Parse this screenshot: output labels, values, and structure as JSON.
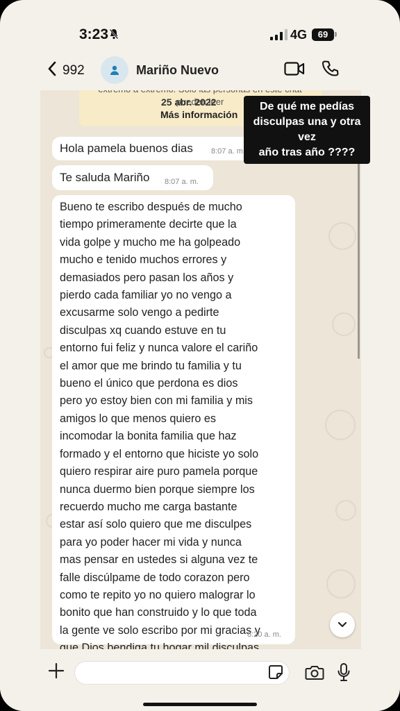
{
  "status_bar": {
    "time": "3:23",
    "network": "4G",
    "battery": "69"
  },
  "header": {
    "back_count": "992",
    "contact_name": "Mariño Nuevo"
  },
  "encryption_notice": {
    "text": "extremo a extremo. Solo las personas en este chat pueden leer",
    "date": "25 abr. 2022",
    "more_info": "Más información"
  },
  "overlay_caption": {
    "line1": "De qué me pedías",
    "line2": "disculpas una y otra vez",
    "line3": "año tras año ????"
  },
  "messages": [
    {
      "text": "Hola pamela buenos dias",
      "time": "8:07 a. m."
    },
    {
      "text": "Te saluda Mariño",
      "time": "8:07 a. m."
    },
    {
      "text": "Bueno te escribo después de mucho\ntiempo primeramente decirte que la\nvida golpe y mucho me ha golpeado\nmucho  e tenido muchos errores y\ndemasiados pero pasan los años y\npierdo cada familiar yo no vengo a\nexcusarme solo vengo a pedirte\ndisculpas xq cuando estuve en tu\nentorno fui feliz y nunca valore el cariño\nel amor que me brindo tu familia y tu\nbueno el único que perdona es dios\npero yo estoy bien con mi familia y mis\namigos lo que menos quiero es\nincomodar la bonita familia que haz\nformado y el entorno que hiciste yo solo\nquiero respirar aire puro pamela porque\nnunca duermo bien porque siempre los\nrecuerdo mucho me carga bastante\nestar así solo quiero que me disculpes\npara yo poder hacer mi vida y nunca\nmas pensar en ustedes  si alguna vez te\nfalle discúlpame de todo corazon pero\ncomo te repito yo no quiero malograr lo\nbonito que han construido y lo que toda\nla gente ve solo escribo por mi gracias y\nque Dios bendiga tu hogar mil disculpas",
      "time": "8:20 a. m."
    }
  ],
  "input": {
    "placeholder": ""
  },
  "icons": {
    "back": "chevron-left-icon",
    "bell": "bell-slash-icon",
    "avatar": "person-icon",
    "video": "video-camera-icon",
    "call": "phone-icon",
    "down": "chevron-down-icon",
    "plus": "plus-icon",
    "sticker": "sticker-icon",
    "camera": "camera-icon",
    "mic": "microphone-icon"
  },
  "colors": {
    "bubble": "#ffffff",
    "chat_bg": "#ece5d8",
    "notice": "#f7ebc8",
    "accent": "#1f7fb8"
  }
}
